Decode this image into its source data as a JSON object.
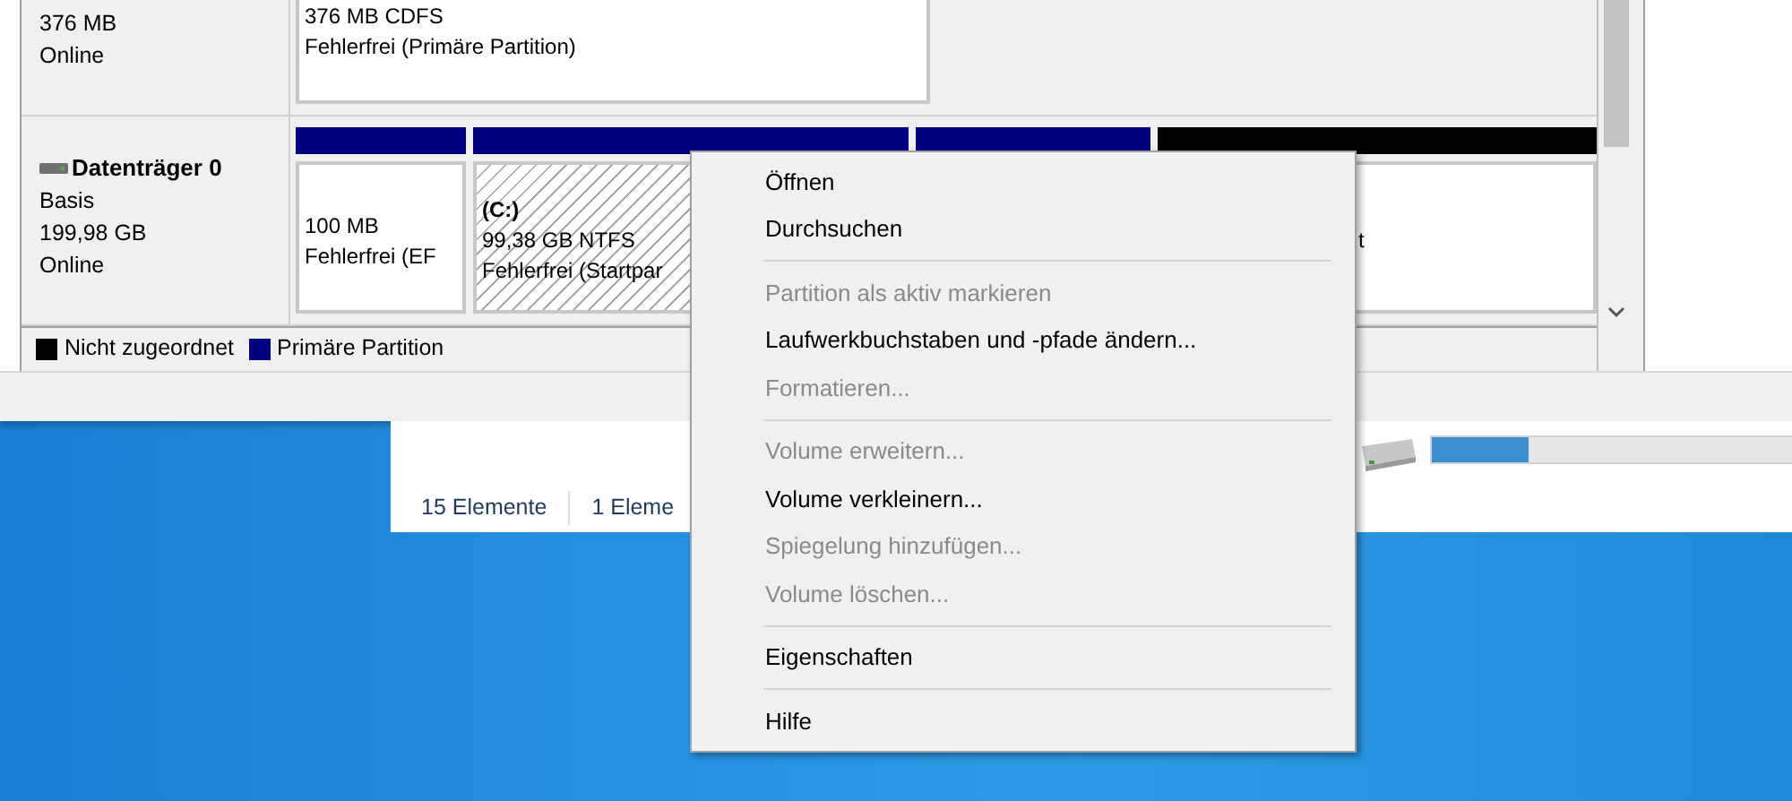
{
  "disks": [
    {
      "lines": [
        "376 MB",
        "Online"
      ],
      "partitions": [
        {
          "kind": "primary",
          "selected": false,
          "lines": [
            "376 MB CDFS",
            "Fehlerfrei (Primäre Partition)"
          ]
        }
      ]
    },
    {
      "name": "Datenträger 0",
      "lines": [
        "Basis",
        "199,98 GB",
        "Online"
      ],
      "partitions": [
        {
          "kind": "primary",
          "selected": false,
          "lines": [
            "100 MB",
            "Fehlerfrei (EF"
          ]
        },
        {
          "kind": "primary",
          "selected": true,
          "title": "(C:)",
          "lines": [
            "99,38 GB NTFS",
            "Fehlerfrei (Startpar"
          ]
        },
        {
          "kind": "primary"
        },
        {
          "kind": "unallocated",
          "selected": false,
          "lines": [
            "t"
          ]
        }
      ]
    }
  ],
  "legend": [
    {
      "color": "#000000",
      "label": "Nicht zugeordnet"
    },
    {
      "color": "#000080",
      "label": "Primäre Partition"
    }
  ],
  "context_menu": [
    {
      "kind": "item",
      "label": "Öffnen",
      "disabled": false
    },
    {
      "kind": "item",
      "label": "Durchsuchen",
      "disabled": false
    },
    {
      "kind": "separator"
    },
    {
      "kind": "item",
      "label": "Partition als aktiv markieren",
      "disabled": true
    },
    {
      "kind": "item",
      "label": "Laufwerkbuchstaben und -pfade ändern...",
      "disabled": false
    },
    {
      "kind": "item",
      "label": "Formatieren...",
      "disabled": true
    },
    {
      "kind": "separator"
    },
    {
      "kind": "item",
      "label": "Volume erweitern...",
      "disabled": true
    },
    {
      "kind": "item",
      "label": "Volume verkleinern...",
      "disabled": false
    },
    {
      "kind": "item",
      "label": "Spiegelung hinzufügen...",
      "disabled": true
    },
    {
      "kind": "item",
      "label": "Volume löschen...",
      "disabled": true
    },
    {
      "kind": "separator"
    },
    {
      "kind": "item",
      "label": "Eigenschaften",
      "disabled": false
    },
    {
      "kind": "separator"
    },
    {
      "kind": "item",
      "label": "Hilfe",
      "disabled": false
    }
  ],
  "explorer": {
    "drive": {
      "level": 0.27
    },
    "status_bar": [
      "15 Elemente",
      "1 Eleme"
    ]
  }
}
